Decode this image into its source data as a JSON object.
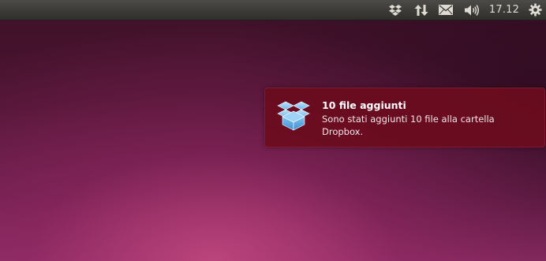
{
  "panel": {
    "indicators": [
      {
        "name": "dropbox",
        "icon": "dropbox-icon"
      },
      {
        "name": "network",
        "icon": "network-updown-icon"
      },
      {
        "name": "messaging",
        "icon": "envelope-icon"
      },
      {
        "name": "sound",
        "icon": "speaker-icon"
      },
      {
        "name": "session",
        "icon": "gear-icon"
      }
    ],
    "clock": "17.12"
  },
  "notification": {
    "icon": "dropbox-icon",
    "title": "10 file aggiunti",
    "body": "Sono stati aggiunti 10 file alla cartella Dropbox."
  },
  "colors": {
    "panel": "#3c3b37",
    "panel_text": "#dfdbd2",
    "notification_bg": "#6c0c1e",
    "dropbox_blue": "#5aa9e6"
  }
}
